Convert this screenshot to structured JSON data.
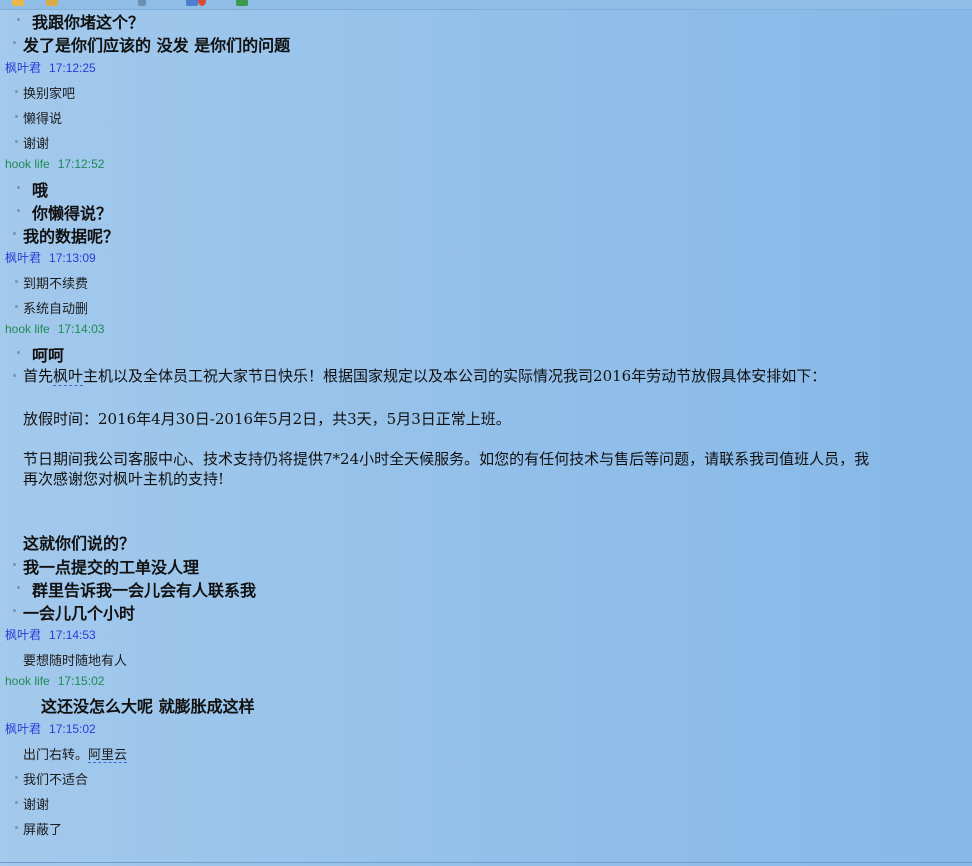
{
  "messages": {
    "m1": "我跟你堵这个？",
    "m2": "发了是你们应该的   没发 是你们的问题",
    "h1_name": "枫叶君",
    "h1_time": "17:12:25",
    "m3": "换别家吧",
    "m4": "懒得说",
    "m5": "谢谢",
    "h2_name": "hook life",
    "h2_time": "17:12:52",
    "m6": "哦",
    "m7": "你懒得说？",
    "m8": "我的数据呢？",
    "h3_name": "枫叶君",
    "h3_time": "17:13:09",
    "m9": "到期不续费",
    "m10": "系统自动删",
    "h4_name": "hook life",
    "h4_time": "17:14:03",
    "m11": "呵呵",
    "n1_a": "首先",
    "n1_b": "枫叶",
    "n1_c": "主机以及全体员工祝大家节日快乐！根据国家规定以及本公司的实际情况我司2016年劳动节放假具体安排如下：",
    "n2": "放假时间：2016年4月30日-2016年5月2日，共3天，5月3日正常上班。",
    "n3": "节日期间我公司客服中心、技术支持仍将提供7*24小时全天候服务。如您的有任何技术与售后等问题，请联系我司值班人员，我",
    "n4": "再次感谢您对枫叶主机的支持!",
    "m12": "这就你们说的？",
    "m13": "我一点提交的工单没人理",
    "m14": "群里告诉我一会儿会有人联系我",
    "m15": "一会儿几个小时",
    "h5_name": "枫叶君",
    "h5_time": "17:14:53",
    "m16": "要想随时随地有人",
    "h6_name": "hook life",
    "h6_time": "17:15:02",
    "m17": "这还没怎么大呢 就膨胀成这样",
    "h7_name": "枫叶君",
    "h7_time": "17:15:02",
    "m18_a": "出门右转。",
    "m18_b": "阿里云",
    "m19": "我们不适合",
    "m20": "谢谢",
    "m21": "屏蔽了"
  },
  "colors": {
    "maple_name": "#2b3bd8",
    "hook_name": "#1d8a55",
    "background": "#93c0ea"
  }
}
